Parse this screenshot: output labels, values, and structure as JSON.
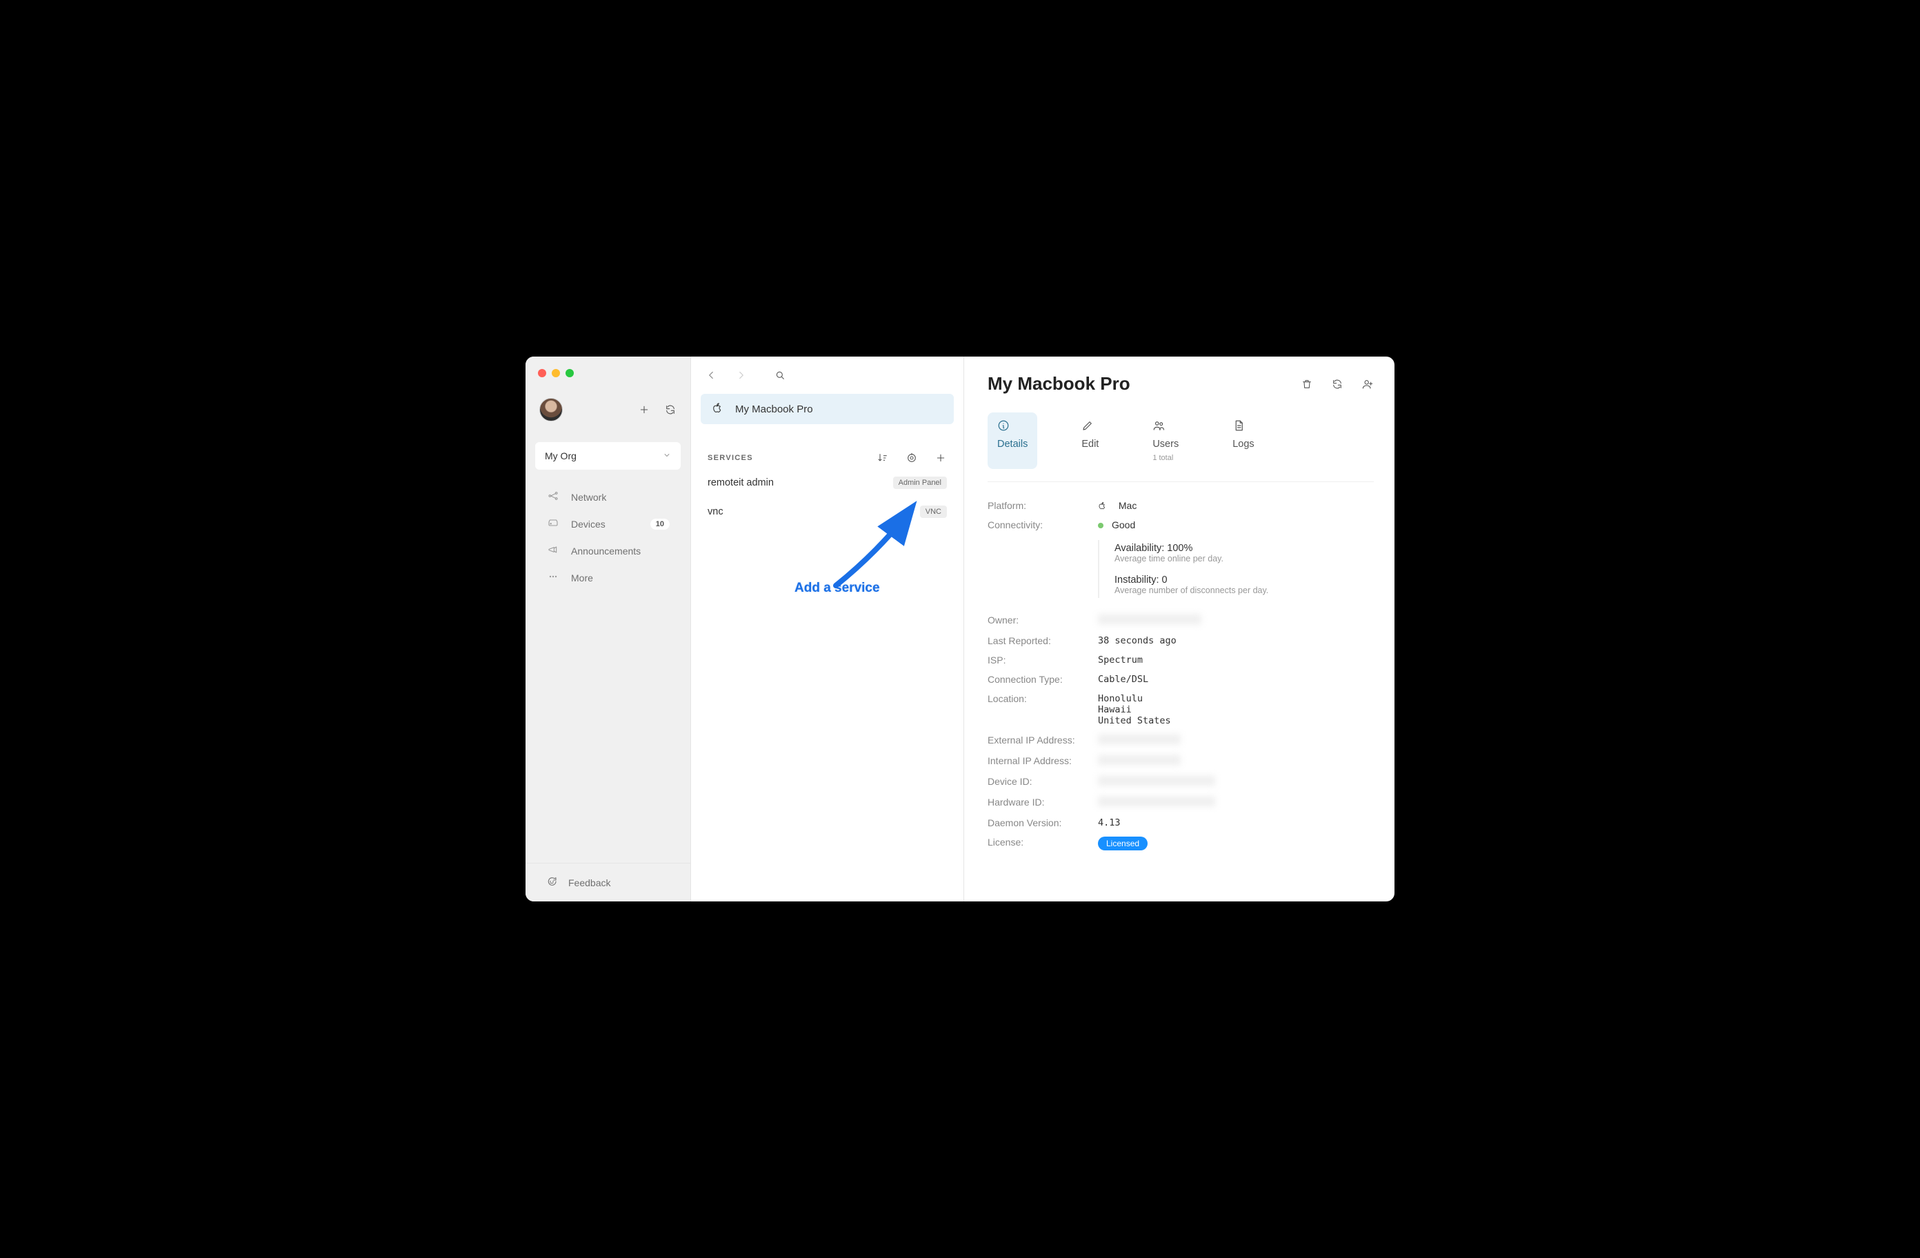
{
  "sidebar": {
    "org_label": "My Org",
    "items": [
      {
        "label": "Network"
      },
      {
        "label": "Devices",
        "count": "10"
      },
      {
        "label": "Announcements"
      },
      {
        "label": "More"
      }
    ],
    "feedback_label": "Feedback"
  },
  "mid": {
    "device_name": "My Macbook Pro",
    "services_heading": "SERVICES",
    "services": [
      {
        "name": "remoteit admin",
        "badge": "Admin Panel"
      },
      {
        "name": "vnc",
        "badge": "VNC"
      }
    ]
  },
  "annotation": {
    "text": "Add a service"
  },
  "detail": {
    "title": "My Macbook Pro",
    "tabs": {
      "details": "Details",
      "edit": "Edit",
      "users": "Users",
      "users_sub": "1 total",
      "logs": "Logs"
    },
    "platform_label": "Platform:",
    "platform_value": "Mac",
    "connectivity_label": "Connectivity:",
    "connectivity_value": "Good",
    "availability_title": "Availability: 100%",
    "availability_sub": "Average time online per day.",
    "instability_title": "Instability: 0",
    "instability_sub": "Average number of disconnects per day.",
    "owner_label": "Owner:",
    "last_reported_label": "Last Reported:",
    "last_reported_value": "38 seconds ago",
    "isp_label": "ISP:",
    "isp_value": "Spectrum",
    "conn_type_label": "Connection Type:",
    "conn_type_value": "Cable/DSL",
    "location_label": "Location:",
    "location_city": "Honolulu",
    "location_state": "Hawaii",
    "location_country": "United States",
    "ext_ip_label": "External IP Address:",
    "int_ip_label": "Internal IP Address:",
    "device_id_label": "Device ID:",
    "hardware_id_label": "Hardware ID:",
    "daemon_label": "Daemon Version:",
    "daemon_value": "4.13",
    "license_label": "License:",
    "license_value": "Licensed"
  }
}
